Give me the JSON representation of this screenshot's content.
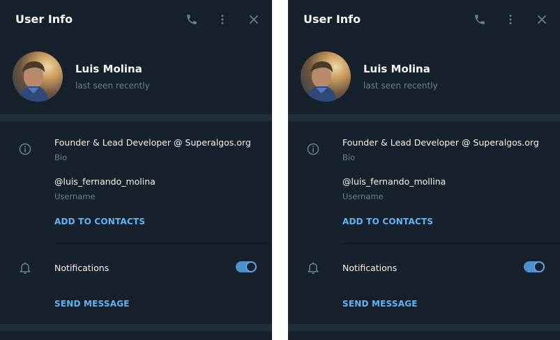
{
  "colors": {
    "panel_bg": "#17212b",
    "band_bg": "#232e3c",
    "accent": "#5eb5f7",
    "muted_text": "#6d7f8f",
    "toggle_on": "#4d8fcf"
  },
  "panels": [
    {
      "header": {
        "title": "User Info",
        "icons": [
          "phone-icon",
          "more-vertical-icon",
          "close-icon"
        ]
      },
      "profile": {
        "name": "Luis Molina",
        "status": "last seen recently"
      },
      "info": {
        "bio_value": "Founder & Lead Developer @ Superalgos.org",
        "bio_label": "Bio",
        "username_value": "@luis_fernando_molina",
        "username_label": "Username",
        "add_contact": "ADD TO CONTACTS"
      },
      "notifications": {
        "label": "Notifications",
        "enabled": true,
        "send_message": "SEND MESSAGE"
      }
    },
    {
      "header": {
        "title": "User Info",
        "icons": [
          "phone-icon",
          "more-vertical-icon",
          "close-icon"
        ]
      },
      "profile": {
        "name": "Luis Molina",
        "status": "last seen recently"
      },
      "info": {
        "bio_value": "Founder & Lead Developer @ Superalgos.org",
        "bio_label": "Bio",
        "username_value": "@luis_fernando_mollina",
        "username_label": "Username",
        "add_contact": "ADD TO CONTACTS"
      },
      "notifications": {
        "label": "Notifications",
        "enabled": true,
        "send_message": "SEND MESSAGE"
      }
    }
  ]
}
